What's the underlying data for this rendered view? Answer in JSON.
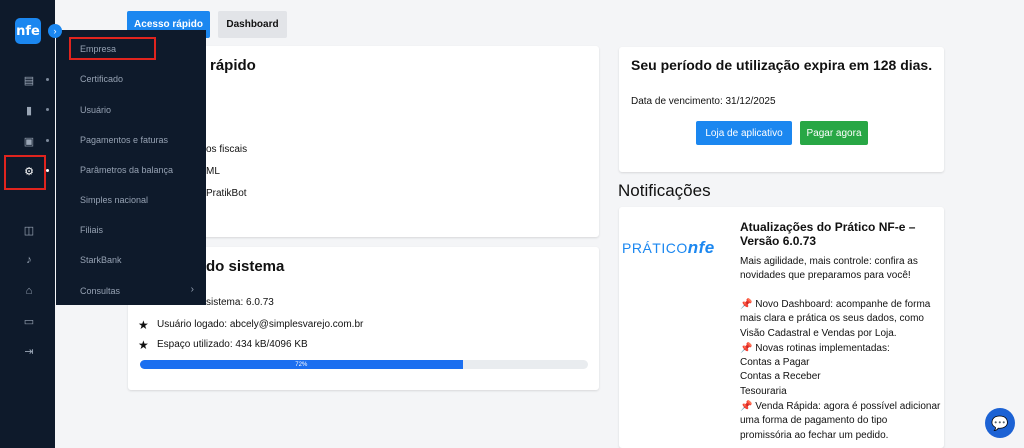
{
  "app": {
    "logo_text": "nfe",
    "expand_icon": "›"
  },
  "sidebar": {
    "icons": [
      {
        "name": "report-icon",
        "glyph": "▤"
      },
      {
        "name": "chart-icon",
        "glyph": "▮"
      },
      {
        "name": "document-icon",
        "glyph": "▣"
      },
      {
        "name": "gear-icon",
        "glyph": "⚙"
      },
      {
        "name": "book-icon",
        "glyph": "◫"
      },
      {
        "name": "microphone-icon",
        "glyph": "♪"
      },
      {
        "name": "bag-icon",
        "glyph": "⌂"
      },
      {
        "name": "monitor-icon",
        "glyph": "▭"
      },
      {
        "name": "logout-icon",
        "glyph": "⇥"
      }
    ]
  },
  "submenu": {
    "items": [
      "Empresa",
      "Certificado",
      "Usuário",
      "Pagamentos e faturas",
      "Parâmetros da balança",
      "Simples nacional",
      "Filiais",
      "StarkBank",
      "Consultas"
    ],
    "chevron": "›"
  },
  "tabs": {
    "active": "Acesso rápido",
    "inactive": "Dashboard"
  },
  "quick_access": {
    "title_partial": "rápido",
    "items": [
      "os fiscais",
      "ML",
      "PratikBot"
    ]
  },
  "system_info": {
    "title_partial": "do sistema",
    "version": "sistema: 6.0.73",
    "user": "Usuário logado: abcely@simplesvarejo.com.br",
    "space": "Espaço utilizado: 434 kB/4096 KB",
    "progress_label": "72%",
    "progress_fraction": 0.72
  },
  "subscription": {
    "title": "Seu período de utilização expira em 128 dias.",
    "due_date": "Data de vencimento: 31/12/2025",
    "store_button": "Loja de aplicativo",
    "pay_button": "Pagar agora"
  },
  "notifications": {
    "heading": "Notificações",
    "brand_a": "PRÁTICO",
    "brand_b": "nfe",
    "title": "Atualizações do Prático NF-e – Versão 6.0.73",
    "body": [
      "Mais agilidade, mais controle: confira as",
      "novidades que preparamos para você!",
      "",
      "📌 Novo Dashboard: acompanhe de forma",
      "mais clara e prática os seus dados, como",
      "Visão Cadastral e Vendas por Loja.",
      "📌 Novas rotinas implementadas:",
      "Contas a Pagar",
      "Contas a Receber",
      "Tesouraria",
      "📌 Venda Rápida: agora é possível adicionar",
      "uma forma de pagamento do tipo",
      "promissória ao fechar um pedido."
    ]
  },
  "chat": {
    "glyph": "💬"
  }
}
